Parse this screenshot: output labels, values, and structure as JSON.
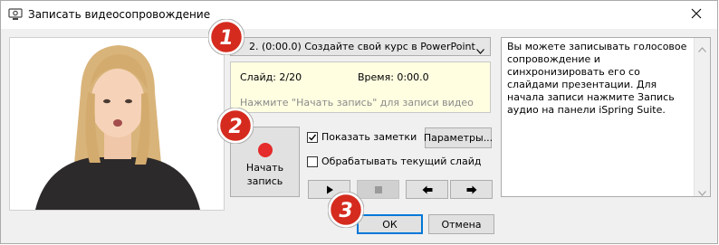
{
  "window": {
    "title": "Записать видеосопровождение"
  },
  "slide_select": {
    "value": "2. (0:00.0) Создайте свой курс в PowerPoint"
  },
  "info": {
    "slide": "Слайд: 2/20",
    "time": "Время: 0:00.0",
    "hint": "Нажмите \"Начать запись\" для записи видео"
  },
  "record": {
    "label_line1": "Начать",
    "label_line2": "запись"
  },
  "options": {
    "show_notes": "Показать заметки",
    "show_notes_checked": true,
    "process_current": "Обрабатывать текущий слайд",
    "process_current_checked": false,
    "params_button": "Параметры..."
  },
  "notes": {
    "text": "Вы можете записывать голосовое сопровождение и синхронизировать его со слайдами презентации. Для начала записи нажмите Запись аудио на панели iSpring Suite."
  },
  "footer": {
    "ok": "ОК",
    "cancel": "Отмена"
  },
  "badges": [
    "1",
    "2",
    "3"
  ],
  "colors": {
    "accent": "#0078d7",
    "record": "#e52b2b",
    "badge_red": "#d52b1e",
    "info_bg": "#fffee1"
  },
  "icons": [
    "webcam-icon",
    "close-icon",
    "play-icon",
    "stop-icon",
    "prev-icon",
    "next-icon"
  ]
}
